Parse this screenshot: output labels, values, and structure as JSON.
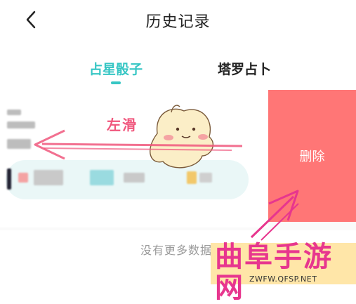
{
  "header": {
    "title": "历史记录",
    "back_icon": "chevron-left-icon"
  },
  "tabs": [
    {
      "label": "占星骰子",
      "active": true
    },
    {
      "label": "塔罗占卜",
      "active": false
    }
  ],
  "colors": {
    "accent": "#36c6c4",
    "delete": "#ff7676",
    "annotation": "#f0577d"
  },
  "row": {
    "delete_label": "删除"
  },
  "annotation": {
    "swipe_label": "左滑"
  },
  "footer": {
    "no_more_text": "没有更多数据"
  },
  "watermark": {
    "brand": "曲阜手游网",
    "url": "ZWFW.QFSP.NET"
  }
}
